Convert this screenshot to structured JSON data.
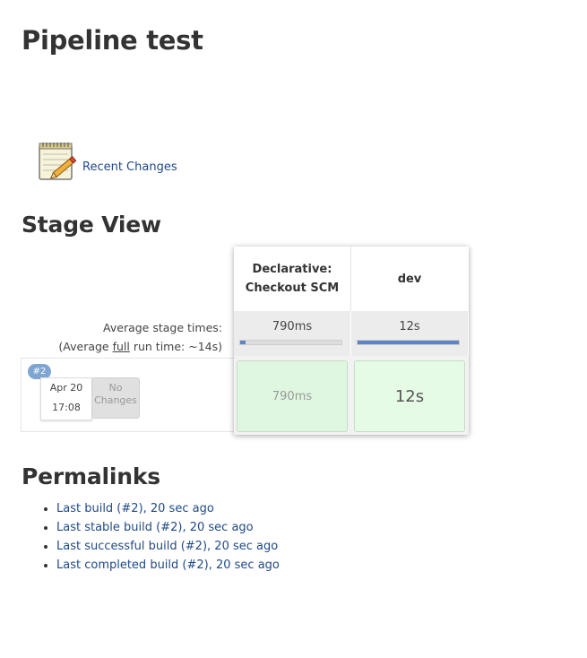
{
  "page": {
    "title": "Pipeline test"
  },
  "recent_changes": {
    "label": "Recent Changes",
    "icon": "notepad-pencil-icon"
  },
  "stage_view": {
    "heading": "Stage View",
    "avg_label_line1": "Average stage times:",
    "avg_label_line2_pre": "(Average ",
    "avg_label_line2_u": "full",
    "avg_label_line2_post": " run time: ~14s)",
    "stages": [
      {
        "name_line1": "Declarative:",
        "name_line2": "Checkout SCM",
        "avg": "790ms",
        "avg_fraction": 0.05,
        "cell": "790ms"
      },
      {
        "name_line1": "",
        "name_line2": "dev",
        "avg": "12s",
        "avg_fraction": 1.0,
        "cell": "12s"
      }
    ],
    "build": {
      "badge": "#2",
      "date": "Apr 20",
      "time": "17:08",
      "changes_line1": "No",
      "changes_line2": "Changes"
    },
    "colors": {
      "success_cell": "#dff7e0",
      "bar": "#5b84c9",
      "badge": "#7fa6d2"
    }
  },
  "permalinks": {
    "heading": "Permalinks",
    "items": [
      "Last build (#2), 20 sec ago",
      "Last stable build (#2), 20 sec ago",
      "Last successful build (#2), 20 sec ago",
      "Last completed build (#2), 20 sec ago"
    ]
  }
}
